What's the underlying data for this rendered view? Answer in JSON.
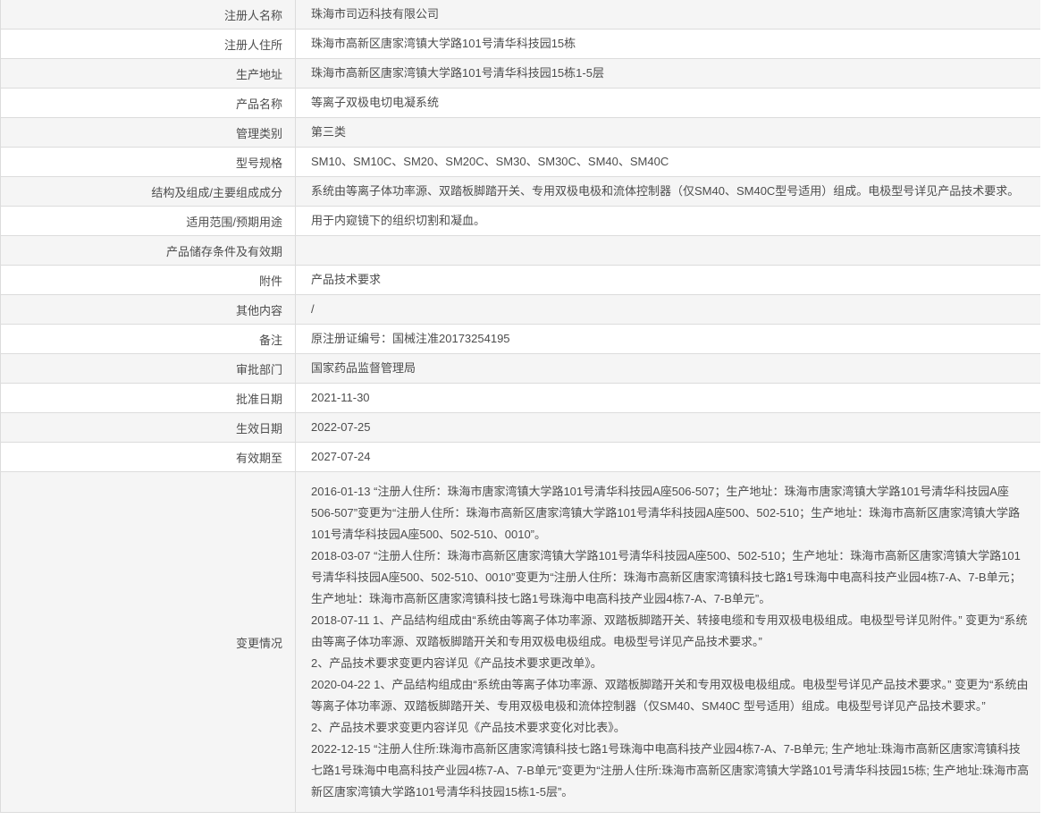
{
  "table": {
    "rows": [
      {
        "label": "注册人名称",
        "value": "珠海市司迈科技有限公司"
      },
      {
        "label": "注册人住所",
        "value": "珠海市高新区唐家湾镇大学路101号清华科技园15栋"
      },
      {
        "label": "生产地址",
        "value": "珠海市高新区唐家湾镇大学路101号清华科技园15栋1-5层"
      },
      {
        "label": "产品名称",
        "value": "等离子双极电切电凝系统"
      },
      {
        "label": "管理类别",
        "value": "第三类"
      },
      {
        "label": "型号规格",
        "value": "SM10、SM10C、SM20、SM20C、SM30、SM30C、SM40、SM40C"
      },
      {
        "label": "结构及组成/主要组成成分",
        "value": "系统由等离子体功率源、双踏板脚踏开关、专用双极电极和流体控制器（仅SM40、SM40C型号适用）组成。电极型号详见产品技术要求。"
      },
      {
        "label": "适用范围/预期用途",
        "value": "用于内窥镜下的组织切割和凝血。"
      },
      {
        "label": "产品储存条件及有效期",
        "value": ""
      },
      {
        "label": "附件",
        "value": "产品技术要求"
      },
      {
        "label": "其他内容",
        "value": "/"
      },
      {
        "label": "备注",
        "value": "原注册证编号：国械注准20173254195"
      },
      {
        "label": "审批部门",
        "value": "国家药品监督管理局"
      },
      {
        "label": "批准日期",
        "value": "2021-11-30"
      },
      {
        "label": "生效日期",
        "value": "2022-07-25"
      },
      {
        "label": "有效期至",
        "value": "2027-07-24"
      }
    ],
    "change_row": {
      "label": "变更情况",
      "paragraphs": [
        "2016-01-13 “注册人住所：珠海市唐家湾镇大学路101号清华科技园A座506-507；生产地址：珠海市唐家湾镇大学路101号清华科技园A座506-507”变更为“注册人住所：珠海市高新区唐家湾镇大学路101号清华科技园A座500、502-510；生产地址：珠海市高新区唐家湾镇大学路101号清华科技园A座500、502-510、0010”。",
        "2018-03-07 “注册人住所：珠海市高新区唐家湾镇大学路101号清华科技园A座500、502-510；生产地址：珠海市高新区唐家湾镇大学路101号清华科技园A座500、502-510、0010”变更为“注册人住所：珠海市高新区唐家湾镇科技七路1号珠海中电高科技产业园4栋7-A、7-B单元；生产地址：珠海市高新区唐家湾镇科技七路1号珠海中电高科技产业园4栋7-A、7-B单元”。",
        "2018-07-11 1、产品结构组成由“系统由等离子体功率源、双踏板脚踏开关、转接电缆和专用双极电极组成。电极型号详见附件。” 变更为“系统由等离子体功率源、双踏板脚踏开关和专用双极电极组成。电极型号详见产品技术要求。”",
        "2、产品技术要求变更内容详见《产品技术要求更改单》。",
        "2020-04-22 1、产品结构组成由“系统由等离子体功率源、双踏板脚踏开关和专用双极电极组成。电极型号详见产品技术要求。” 变更为“系统由等离子体功率源、双踏板脚踏开关、专用双极电极和流体控制器（仅SM40、SM40C 型号适用）组成。电极型号详见产品技术要求。”",
        "2、产品技术要求变更内容详见《产品技术要求变化对比表》。",
        "2022-12-15 “注册人住所:珠海市高新区唐家湾镇科技七路1号珠海中电高科技产业园4栋7-A、7-B单元; 生产地址:珠海市高新区唐家湾镇科技七路1号珠海中电高科技产业园4栋7-A、7-B单元”变更为“注册人住所:珠海市高新区唐家湾镇大学路101号清华科技园15栋; 生产地址:珠海市高新区唐家湾镇大学路101号清华科技园15栋1-5层”。"
      ]
    }
  },
  "colors": {
    "row_alt_bg": "#f5f5f5",
    "border": "#dcdcdc",
    "text": "#4d4d4d"
  }
}
